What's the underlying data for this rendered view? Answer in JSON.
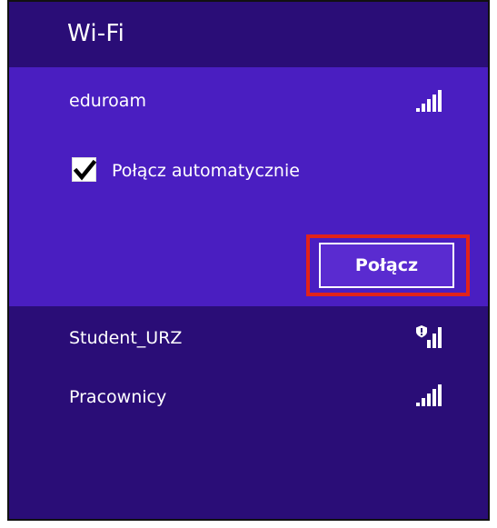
{
  "window": {
    "title": "Wi-Fi"
  },
  "networks": [
    {
      "name": "eduroam",
      "secured": false,
      "signal": "signal-full-icon",
      "selected": true,
      "auto_connect_label": "Połącz automatycznie",
      "auto_connect_checked": true,
      "connect_label": "Połącz"
    },
    {
      "name": "Student_URZ",
      "secured": true,
      "signal": "signal-secured-icon",
      "selected": false
    },
    {
      "name": "Pracownicy",
      "secured": false,
      "signal": "signal-full-icon",
      "selected": false
    }
  ],
  "colors": {
    "panel_background": "#2a0d77",
    "selected_background": "#4a1ec1",
    "highlight": "#e2231a",
    "text": "#ffffff"
  }
}
